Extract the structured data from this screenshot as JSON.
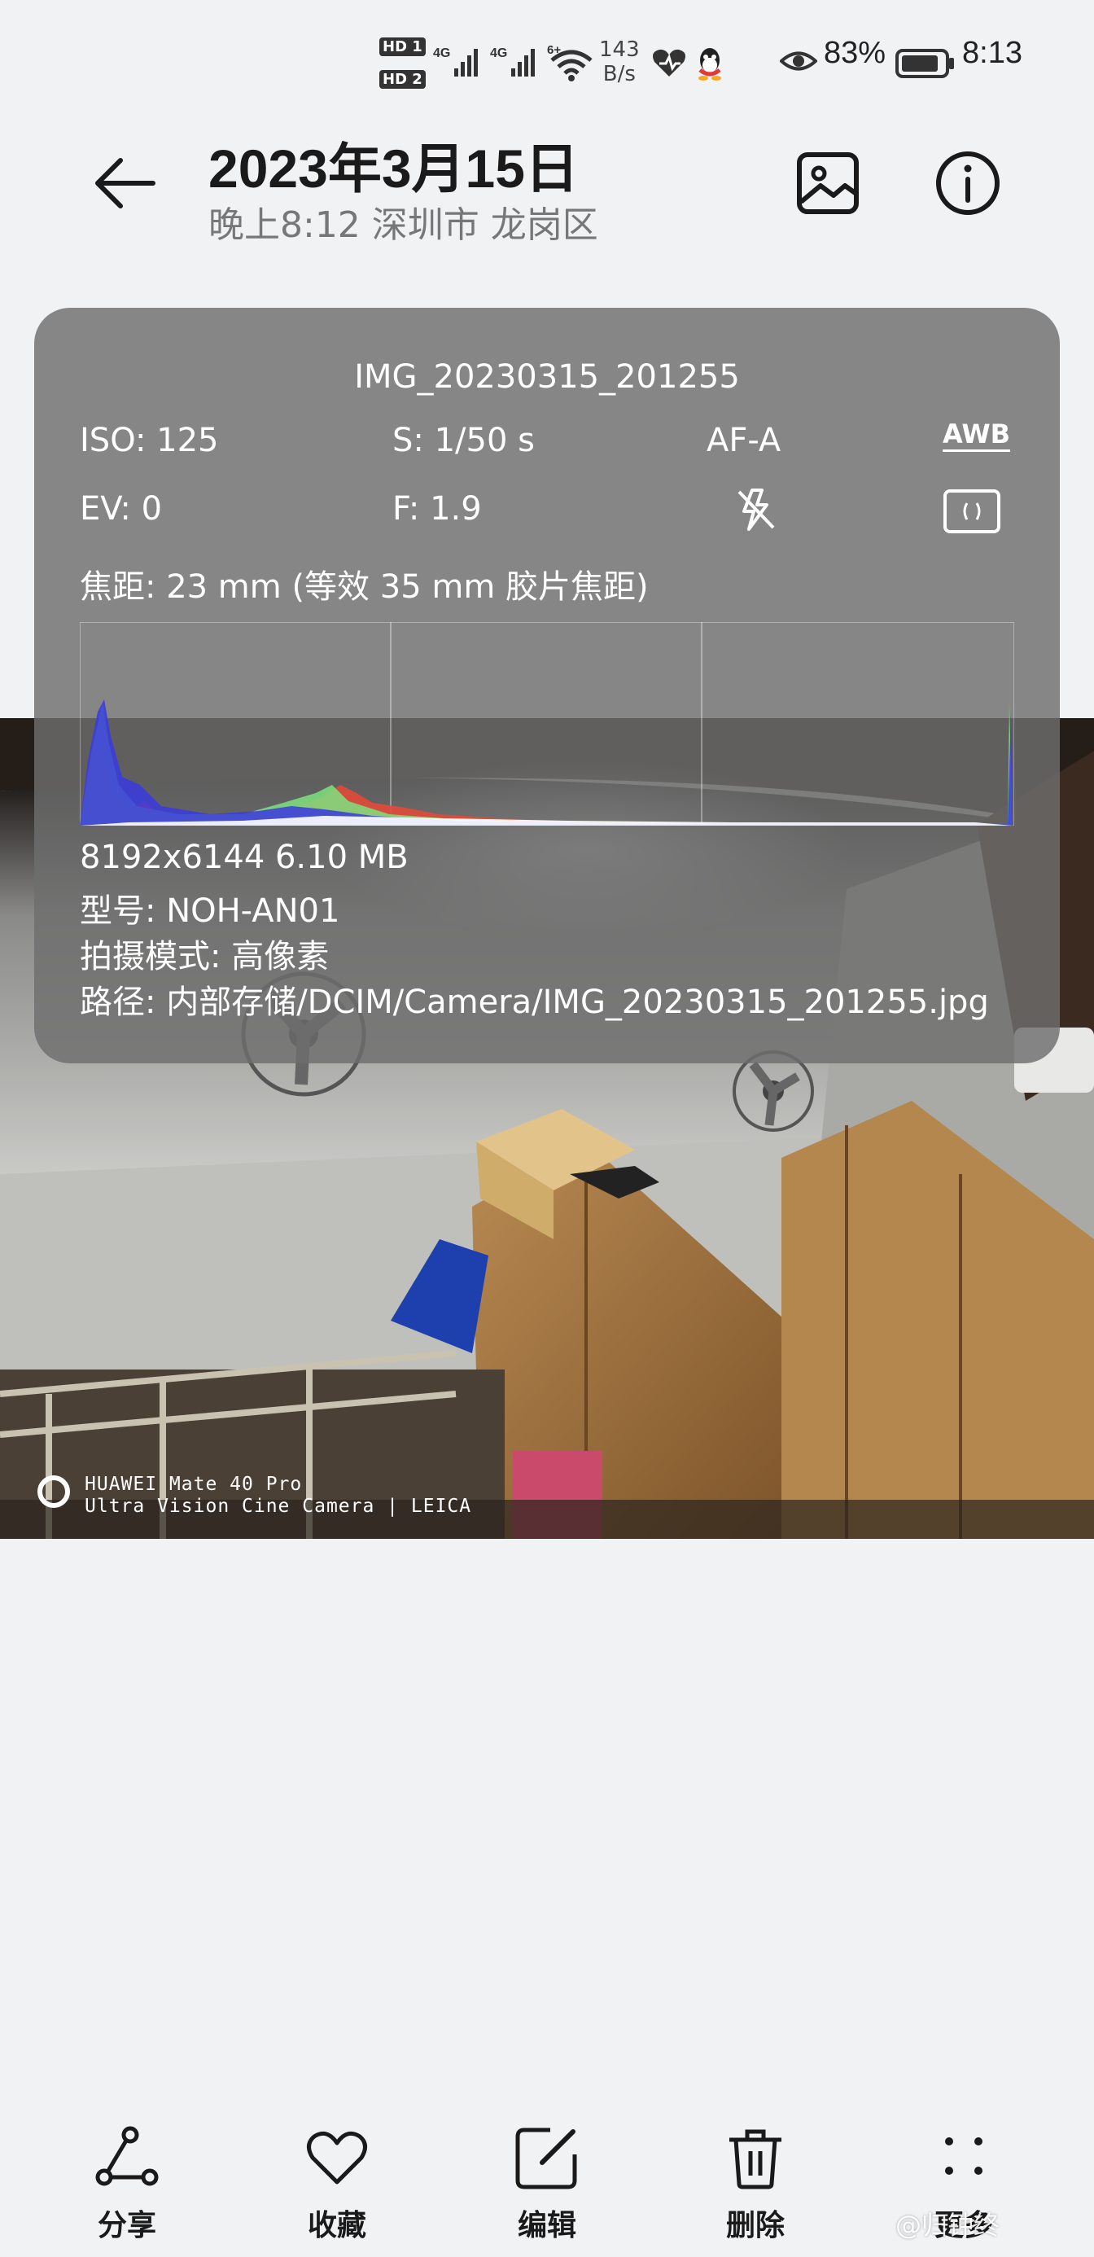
{
  "status_bar": {
    "hd1": "HD 1",
    "hd2": "HD 2",
    "signal1": "4G",
    "signal2": "4G",
    "wifi": "6+",
    "net_speed_value": "143",
    "net_speed_unit": "B/s",
    "battery": "83%",
    "time": "8:13"
  },
  "header": {
    "title": "2023年3月15日",
    "subtitle": "晚上8:12 深圳市 龙岗区"
  },
  "info": {
    "file_name": "IMG_20230315_201255",
    "iso": "ISO: 125",
    "shutter": "S: 1/50 s",
    "af_mode": "AF-A",
    "wb": "AWB",
    "ev": "EV: 0",
    "aperture": "F: 1.9",
    "focal": "焦距: 23 mm (等效 35 mm 胶片焦距)",
    "resolution_size": "8192x6144  6.10 MB",
    "model": "型号:  NOH-AN01",
    "mode": "拍摄模式:  高像素",
    "path": "路径:  内部存储/DCIM/Camera/IMG_20230315_201255.jpg"
  },
  "watermark": {
    "line1": "HUAWEI Mate 40 Pro",
    "line2": "Ultra Vision Cine Camera | LEICA"
  },
  "bottom_bar": [
    {
      "label": "分享",
      "icon": "share-icon"
    },
    {
      "label": "收藏",
      "icon": "heart-icon"
    },
    {
      "label": "编辑",
      "icon": "edit-icon"
    },
    {
      "label": "删除",
      "icon": "trash-icon"
    },
    {
      "label": "更多",
      "icon": "more-icon"
    }
  ],
  "credit": "@归钟终"
}
